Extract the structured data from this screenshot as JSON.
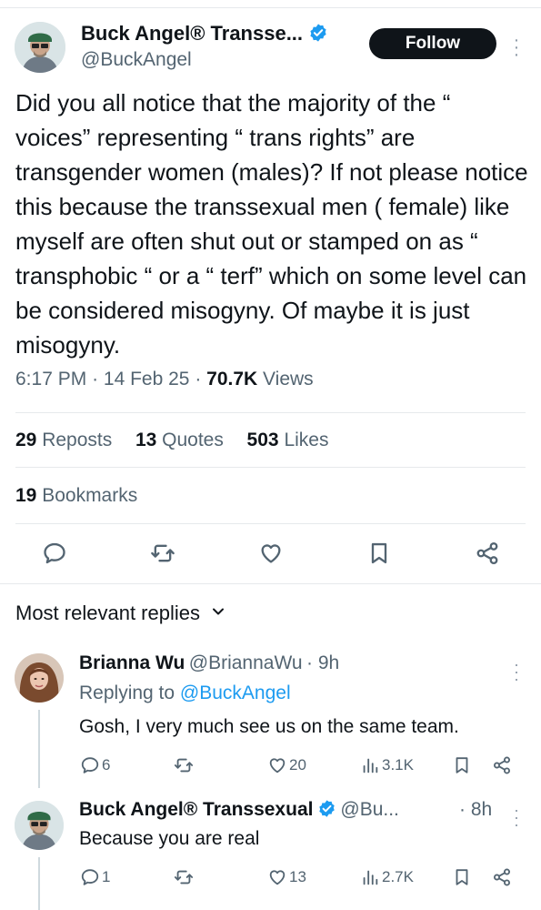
{
  "tweet": {
    "author_name": "Buck Angel® Transse...",
    "author_handle": "@BuckAngel",
    "follow_label": "Follow",
    "text": "Did you all notice that the majority of the “ voices” representing “ trans rights” are transgender women (males)? If not please notice this because the transsexual men ( female) like myself are often shut out or stamped on as “ transphobic “ or a “ terf” which on some level can be considered misogyny. Of maybe it is just misogyny.",
    "time": "6:17 PM",
    "date": "14 Feb 25",
    "views_count": "70.7K",
    "views_label": "Views",
    "reposts_count": "29",
    "reposts_label": "Reposts",
    "quotes_count": "13",
    "quotes_label": "Quotes",
    "likes_count": "503",
    "likes_label": "Likes",
    "bookmarks_count": "19",
    "bookmarks_label": "Bookmarks"
  },
  "replies_header": {
    "label": "Most relevant replies",
    "icon": "chevron-down-icon"
  },
  "replies": [
    {
      "name": "Brianna Wu",
      "handle": "@BriannaWu",
      "time": "9h",
      "replying_prefix": "Replying to",
      "replying_to": "@BuckAngel",
      "text": "Gosh, I very much see us on the same team.",
      "replies_count": "6",
      "reposts_count": "",
      "likes_count": "20",
      "views_count": "3.1K"
    },
    {
      "name": "Buck Angel® Transsexual",
      "handle": "@Bu...",
      "time": "8h",
      "text": "Because you are real",
      "replies_count": "1",
      "reposts_count": "",
      "likes_count": "13",
      "views_count": "2.7K"
    }
  ],
  "colors": {
    "text": "#0f1419",
    "secondary": "#536471",
    "accent": "#1d9bf0",
    "divider": "#e6e9ec"
  }
}
